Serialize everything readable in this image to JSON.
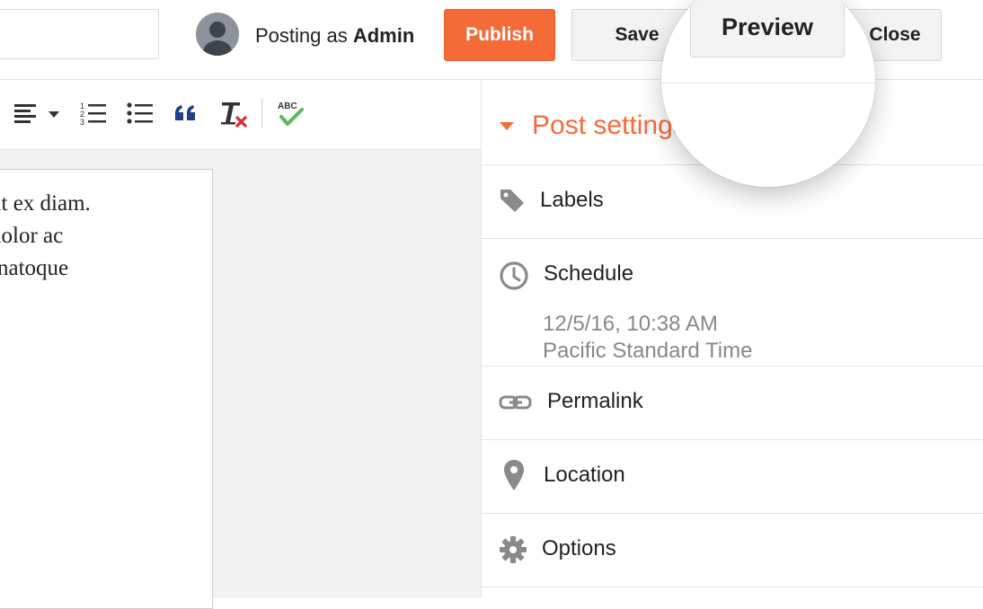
{
  "header": {
    "posting_as_prefix": "Posting as",
    "posting_as_user": "Admin",
    "publish_label": "Publish",
    "save_label": "Save",
    "preview_label": "Preview",
    "close_label": "Close"
  },
  "toolbar": {
    "icons": [
      "align-icon",
      "numbered-list-icon",
      "bulleted-list-icon",
      "quote-icon",
      "remove-formatting-icon",
      "spellcheck-icon"
    ]
  },
  "editor": {
    "lines": [
      "ut ex diam.",
      "dolor ac",
      "natoque"
    ]
  },
  "sidebar": {
    "title": "Post settings",
    "items": [
      {
        "label": "Labels",
        "icon": "tag-icon"
      },
      {
        "label": "Schedule",
        "icon": "clock-icon",
        "date": "12/5/16, 10:38 AM",
        "timezone": "Pacific Standard Time"
      },
      {
        "label": "Permalink",
        "icon": "link-icon"
      },
      {
        "label": "Location",
        "icon": "location-pin-icon"
      },
      {
        "label": "Options",
        "icon": "gear-icon"
      }
    ]
  },
  "colors": {
    "accent": "#f56b38",
    "toolbar_icon": "#333333",
    "quote_icon": "#1f3f86",
    "spellcheck_check": "#5cb85c",
    "remove_x": "#d32f2f"
  }
}
